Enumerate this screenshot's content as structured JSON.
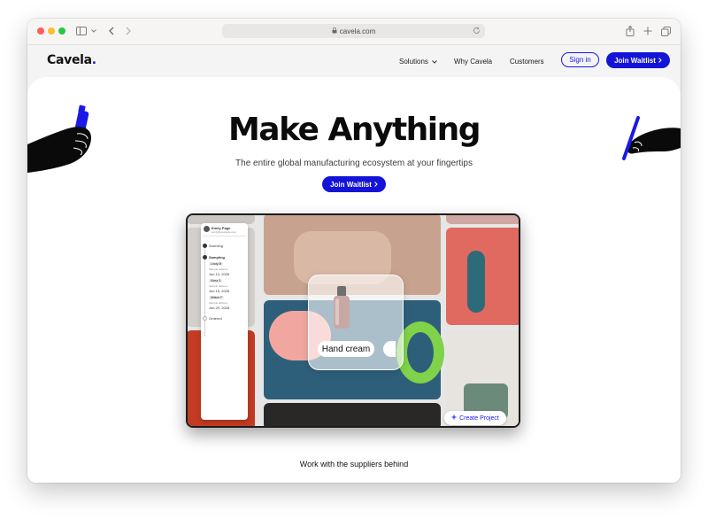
{
  "browser": {
    "url": "cavela.com",
    "traffic_lights": [
      "#fe5f57",
      "#febc2e",
      "#28c840"
    ],
    "icons": [
      "sidebar-icon",
      "chevron-down-icon",
      "back-icon",
      "forward-icon",
      "lock-icon",
      "reload-icon",
      "share-icon",
      "new-tab-icon",
      "tabs-icon"
    ]
  },
  "nav": {
    "logo": "Cavela",
    "logo_dot": ".",
    "links": [
      "Solutions",
      "Why Cavela",
      "Customers"
    ],
    "signin": "Sign in",
    "waitlist": "Join Waitlist"
  },
  "hero": {
    "title": "Make Anything",
    "subtitle": "The entire global manufacturing ecosystem at your fingertips",
    "cta": "Join Waitlist"
  },
  "app_preview": {
    "user_name": "Emily Page",
    "user_email": "emily@example.com",
    "steps": [
      "Sourcing",
      "Sampling",
      "Ordered"
    ],
    "samples": [
      {
        "tag": "Lindy M",
        "label": "Sample delivery",
        "date": "Jun 14, 2026"
      },
      {
        "tag": "Kiera S",
        "label": "Sample delivery",
        "date": "Jun 15, 2026"
      },
      {
        "tag": "Allison F",
        "label": "Sample delivery",
        "date": "Jun 20, 2026"
      }
    ],
    "product_label": "Hand cream",
    "create_project": "Create Project"
  },
  "footer": {
    "text": "Work with the suppliers behind"
  },
  "colors": {
    "accent": "#1414d8",
    "page_bg": "#ffffff"
  }
}
